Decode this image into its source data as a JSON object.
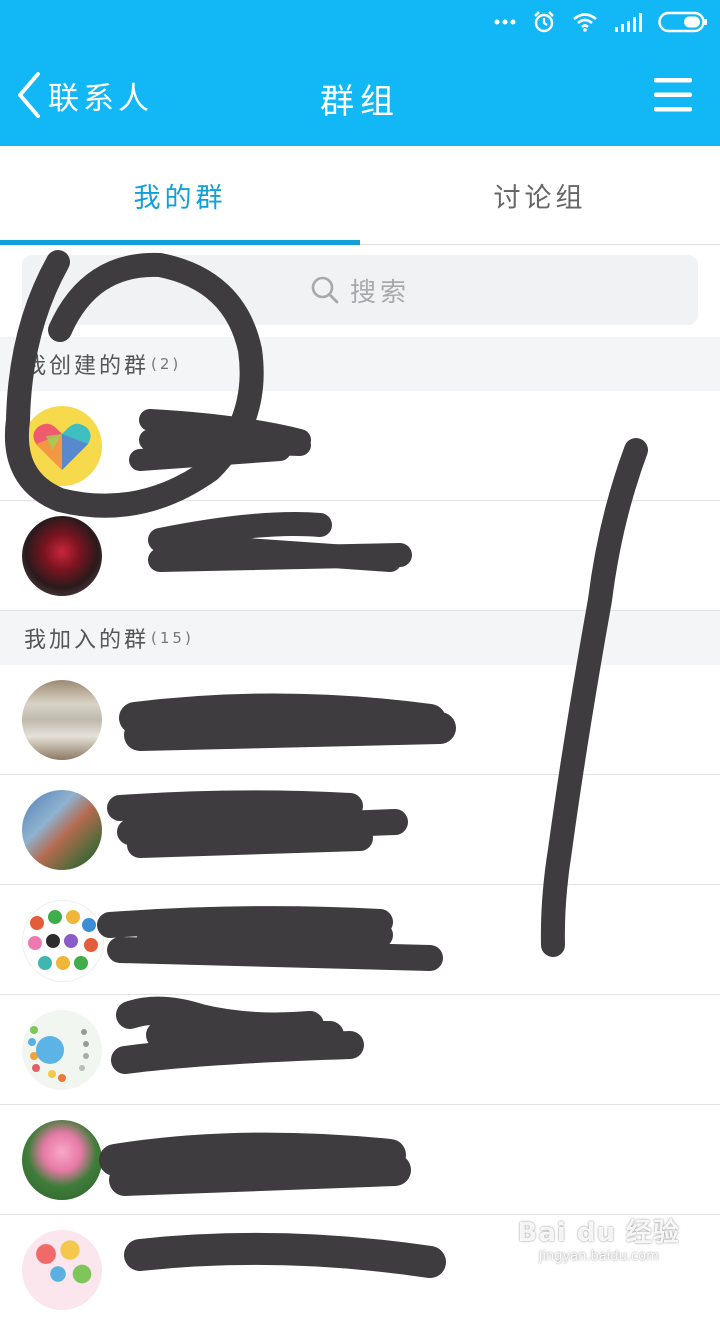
{
  "header": {
    "back_label": "联系人",
    "title": "群组"
  },
  "tabs": [
    {
      "label": "我的群",
      "active": true
    },
    {
      "label": "讨论组",
      "active": false
    }
  ],
  "search": {
    "placeholder": "搜索"
  },
  "sections": [
    {
      "label": "我创建的群",
      "count": "(2)"
    },
    {
      "label": "我加入的群",
      "count": "(15)"
    }
  ],
  "colors": {
    "accent": "#12b7f5",
    "tab_active": "#12a0d8",
    "scribble": "#3e3c3e"
  },
  "icons": [
    "ellipsis-icon",
    "alarm-icon",
    "wifi-icon",
    "signal-icon",
    "battery-icon",
    "chevron-left-icon",
    "menu-icon",
    "search-icon"
  ],
  "watermark": {
    "main": "Bai du 经验",
    "sub": "jingyan.baidu.com"
  }
}
